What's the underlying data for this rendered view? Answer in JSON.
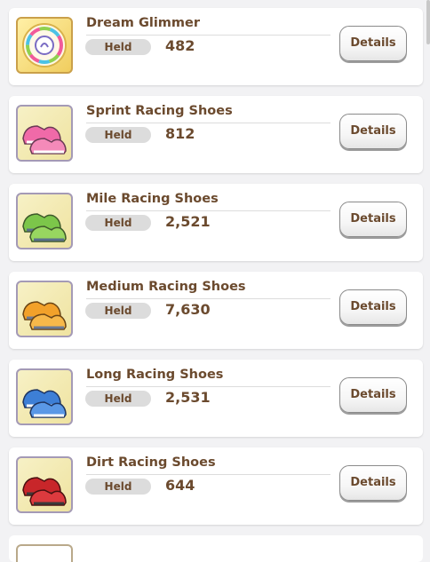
{
  "items": [
    {
      "name": "Dream Glimmer",
      "held_label": "Held",
      "count": "482",
      "details_label": "Details",
      "icon": "dream-glimmer-icon"
    },
    {
      "name": "Sprint Racing Shoes",
      "held_label": "Held",
      "count": "812",
      "details_label": "Details",
      "icon": "pink-shoes-icon",
      "color": "#f06aa8"
    },
    {
      "name": "Mile Racing Shoes",
      "held_label": "Held",
      "count": "2,521",
      "details_label": "Details",
      "icon": "green-shoes-icon",
      "color": "#7cc64a"
    },
    {
      "name": "Medium Racing Shoes",
      "held_label": "Held",
      "count": "7,630",
      "details_label": "Details",
      "icon": "orange-shoes-icon",
      "color": "#f2a12a"
    },
    {
      "name": "Long Racing Shoes",
      "held_label": "Held",
      "count": "2,531",
      "details_label": "Details",
      "icon": "blue-shoes-icon",
      "color": "#3d7fd6"
    },
    {
      "name": "Dirt Racing Shoes",
      "held_label": "Held",
      "count": "644",
      "details_label": "Details",
      "icon": "red-shoes-icon",
      "color": "#c8262a"
    }
  ]
}
